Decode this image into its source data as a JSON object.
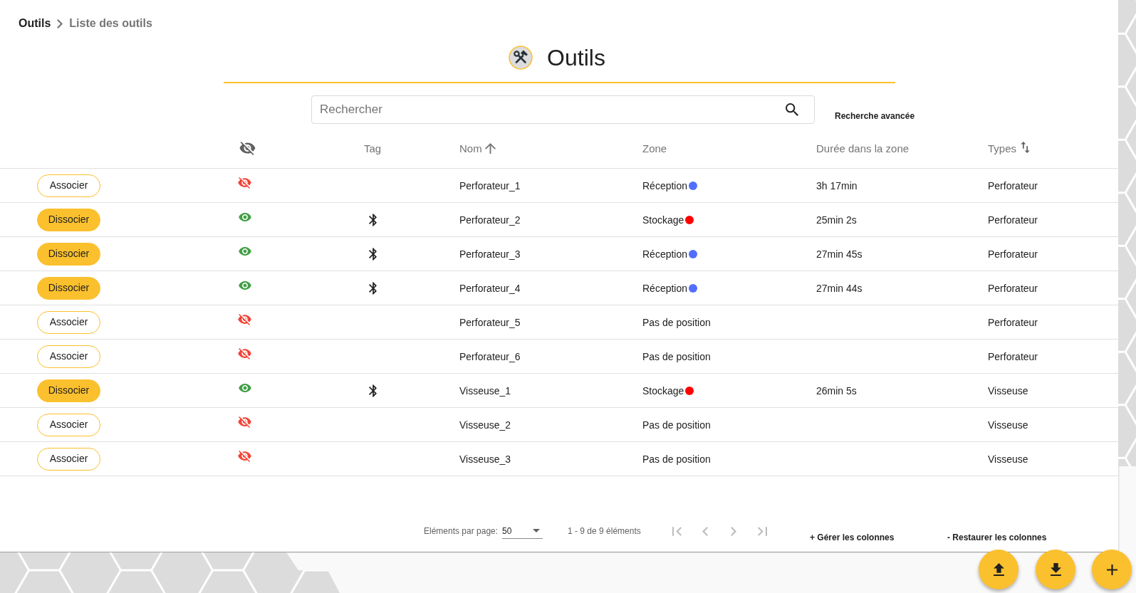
{
  "breadcrumb": [
    {
      "label": "Outils",
      "current": false
    },
    {
      "label": "Liste des outils",
      "current": true
    }
  ],
  "title": "Outils",
  "search": {
    "placeholder": "Rechercher"
  },
  "advanced_search": "Recherche avancée",
  "table": {
    "columns": [
      {
        "label": "Tag",
        "kind": "plain"
      },
      {
        "label": "Nom",
        "kind": "sorted"
      },
      {
        "label": "Zone",
        "kind": "plain"
      },
      {
        "label": "Durée dans la zone",
        "kind": "plain"
      },
      {
        "label": "Types",
        "kind": "sortable"
      }
    ],
    "rows": [
      {
        "action": "Associer",
        "associated": false,
        "visible": false,
        "tagged": false,
        "name": "Perforateur_1",
        "zone": {
          "label": "Réception",
          "color": "#536dfe"
        },
        "duration": "3h 17min",
        "type": "Perforateur"
      },
      {
        "action": "Dissocier",
        "associated": true,
        "visible": true,
        "tagged": true,
        "name": "Perforateur_2",
        "zone": {
          "label": "Stockage",
          "color": "#ff0000"
        },
        "duration": "25min 2s",
        "type": "Perforateur"
      },
      {
        "action": "Dissocier",
        "associated": true,
        "visible": true,
        "tagged": true,
        "name": "Perforateur_3",
        "zone": {
          "label": "Réception",
          "color": "#536dfe"
        },
        "duration": "27min 45s",
        "type": "Perforateur"
      },
      {
        "action": "Dissocier",
        "associated": true,
        "visible": true,
        "tagged": true,
        "name": "Perforateur_4",
        "zone": {
          "label": "Réception",
          "color": "#536dfe"
        },
        "duration": "27min 44s",
        "type": "Perforateur"
      },
      {
        "action": "Associer",
        "associated": false,
        "visible": false,
        "tagged": false,
        "name": "Perforateur_5",
        "zone": {
          "label": "Pas de position"
        },
        "type": "Perforateur"
      },
      {
        "action": "Associer",
        "associated": false,
        "visible": false,
        "tagged": false,
        "name": "Perforateur_6",
        "zone": {
          "label": "Pas de position"
        },
        "type": "Perforateur"
      },
      {
        "action": "Dissocier",
        "associated": true,
        "visible": true,
        "tagged": true,
        "name": "Visseuse_1",
        "zone": {
          "label": "Stockage",
          "color": "#ff0000"
        },
        "duration": "26min 5s",
        "type": "Visseuse"
      },
      {
        "action": "Associer",
        "associated": false,
        "visible": false,
        "tagged": false,
        "name": "Visseuse_2",
        "zone": {
          "label": "Pas de position"
        },
        "type": "Visseuse"
      },
      {
        "action": "Associer",
        "associated": false,
        "visible": false,
        "tagged": false,
        "name": "Visseuse_3",
        "zone": {
          "label": "Pas de position"
        },
        "type": "Visseuse"
      }
    ]
  },
  "pagination": {
    "items_per_page_label": "Eléments par page:",
    "page_size": "50",
    "range": "1 - 9 de 9 éléments",
    "nav": [
      {
        "kind": "first",
        "disabled": true
      },
      {
        "kind": "previous",
        "disabled": true
      },
      {
        "kind": "next",
        "disabled": true
      },
      {
        "kind": "last",
        "disabled": true
      }
    ]
  },
  "column_actions": [
    "+ Gérer les colonnes",
    "- Restaurer les colonnes"
  ]
}
